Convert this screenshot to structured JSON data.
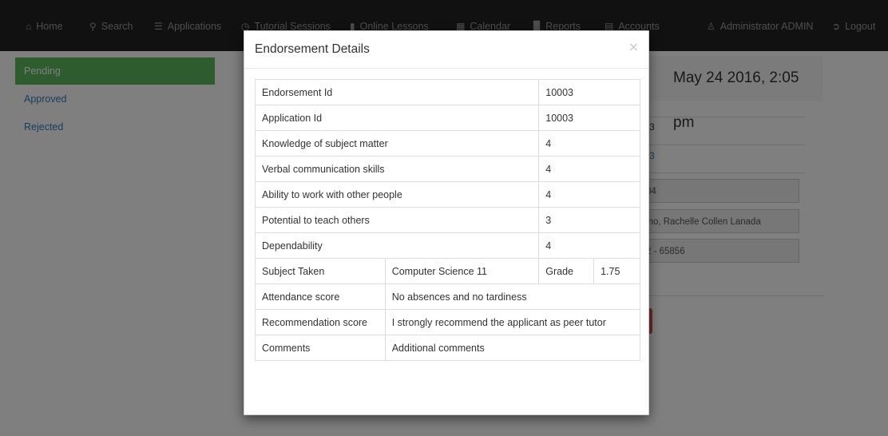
{
  "nav": {
    "home": "Home",
    "search": "Search",
    "applications": "Applications",
    "tutorial_sessions": "Tutorial Sessions",
    "online_lessons": "Online Lessons",
    "calendar": "Calendar",
    "reports": "Reports",
    "accounts": "Accounts",
    "user": "Administrator ADMIN",
    "logout": "Logout"
  },
  "sidebar": {
    "items": [
      {
        "label": "Pending",
        "active": true
      },
      {
        "label": "Approved",
        "active": false
      },
      {
        "label": "Rejected",
        "active": false
      }
    ]
  },
  "background": {
    "date": "May 24 2016, 2:05 pm",
    "fragment_1": "3",
    "fragment_2": "3",
    "field_1": "04",
    "field_2": "ino, Rachelle Collen Lanada",
    "field_3": "2 - 65856"
  },
  "modal": {
    "title": "Endorsement Details",
    "close": "×",
    "rows": {
      "endorsement_id": {
        "label": "Endorsement Id",
        "value": "10003"
      },
      "application_id": {
        "label": "Application Id",
        "value": "10003"
      },
      "knowledge": {
        "label": "Knowledge of subject matter",
        "value": "4"
      },
      "verbal": {
        "label": "Verbal communication skills",
        "value": "4"
      },
      "ability": {
        "label": "Ability to work with other people",
        "value": "4"
      },
      "potential": {
        "label": "Potential to teach others",
        "value": "3"
      },
      "dependability": {
        "label": "Dependability",
        "value": "4"
      },
      "subject": {
        "label": "Subject Taken",
        "value": "Computer Science 11",
        "grade_label": "Grade",
        "grade_value": "1.75"
      },
      "attendance": {
        "label": "Attendance score",
        "value": "No absences and no tardiness"
      },
      "recommendation": {
        "label": "Recommendation score",
        "value": "I strongly recommend the applicant as peer tutor"
      },
      "comments": {
        "label": "Comments",
        "value": "Additional comments"
      }
    }
  },
  "colors": {
    "navbar": "#222222",
    "active_sidebar": "#5cb85c",
    "link": "#337ab7",
    "danger": "#d9534f"
  }
}
